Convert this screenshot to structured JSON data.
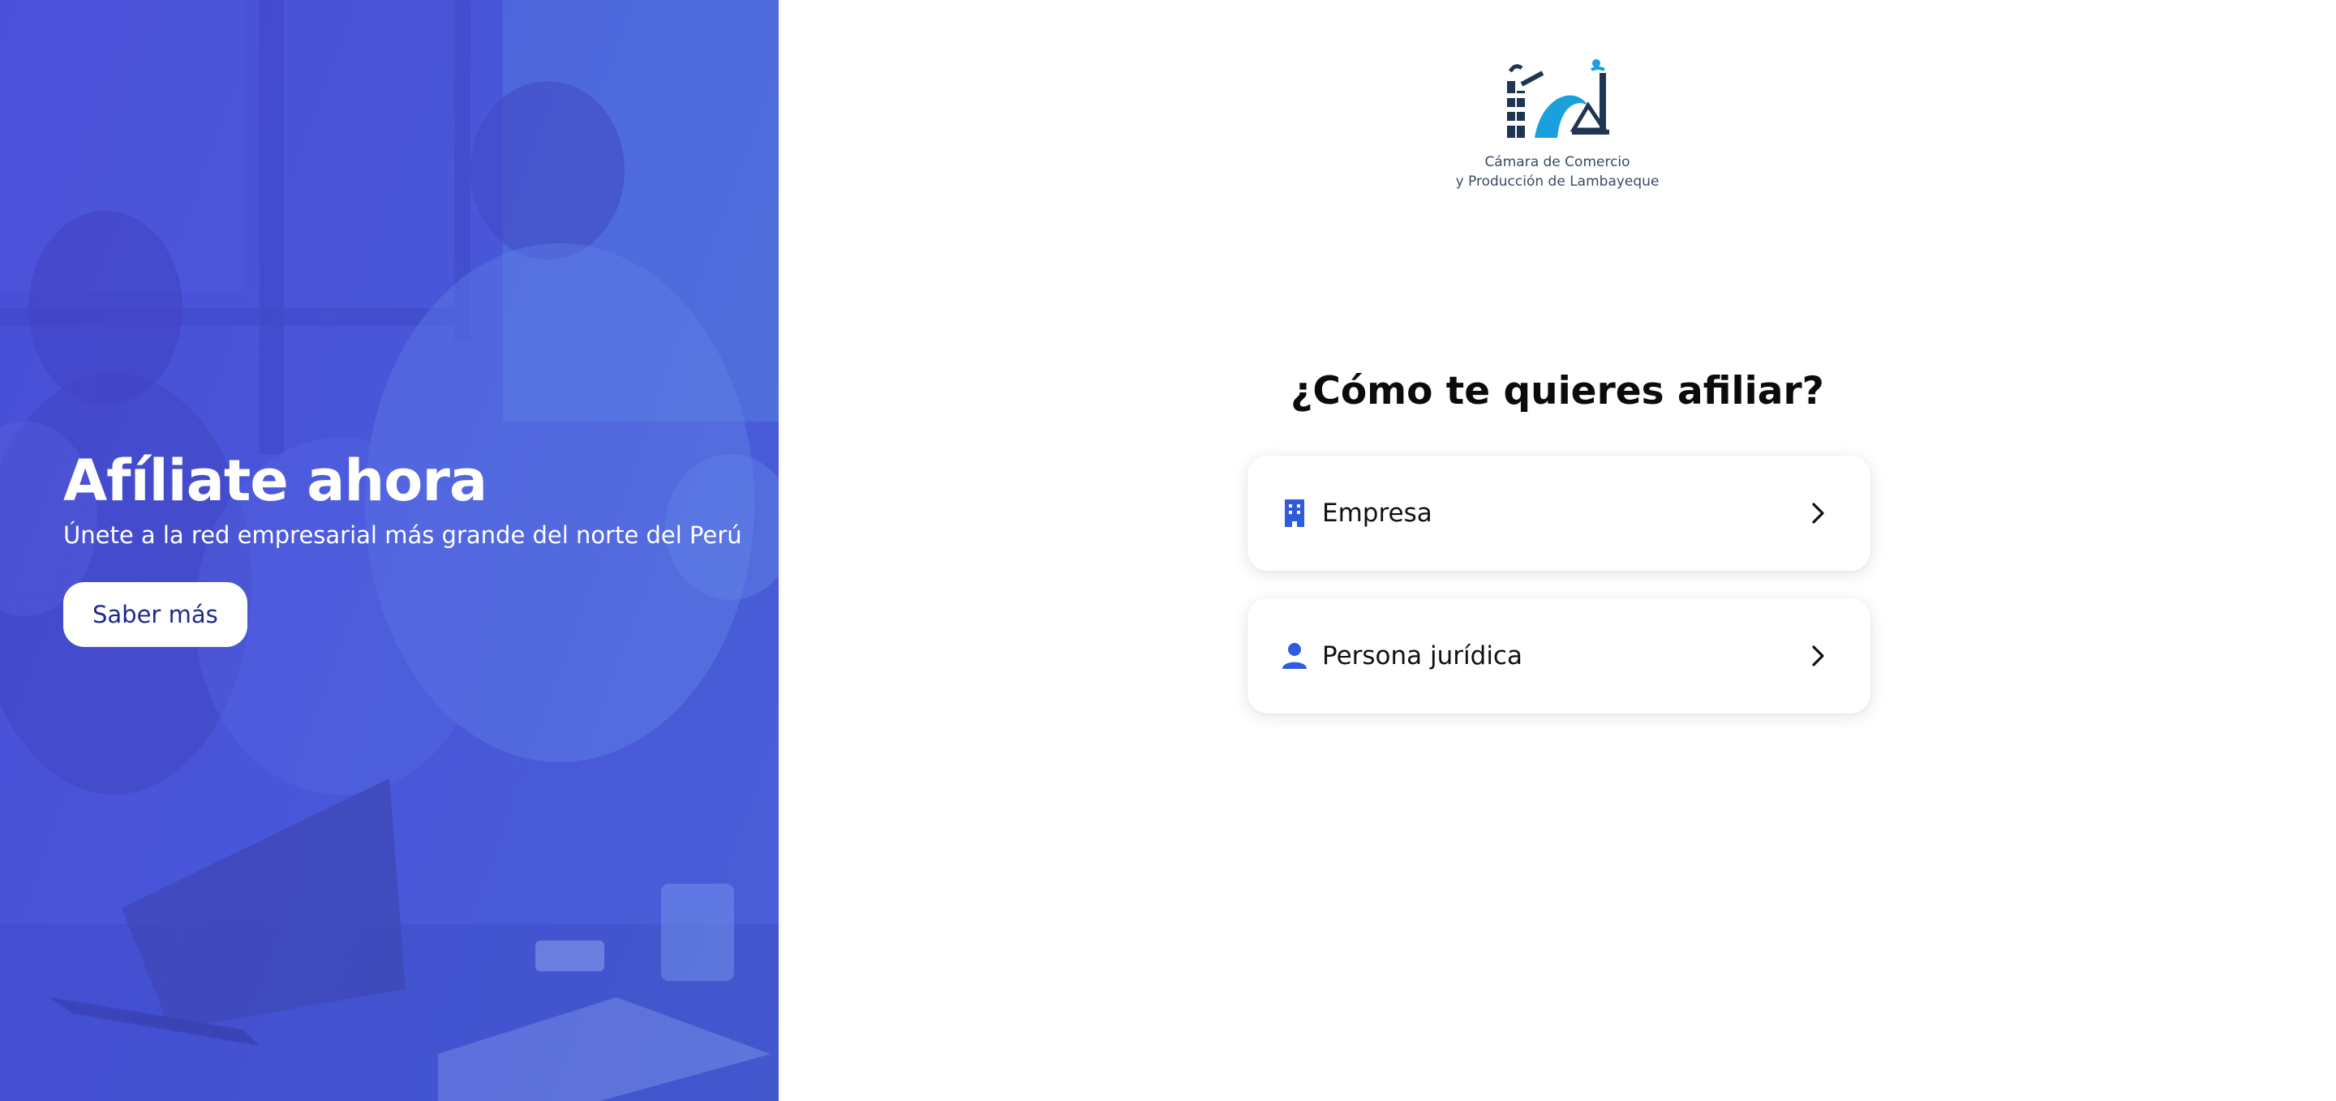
{
  "hero": {
    "title": "Afíliate ahora",
    "subtitle": "Únete a la red empresarial más grande del norte del Perú",
    "button_label": "Saber más"
  },
  "logo": {
    "line1": "Cámara de Comercio",
    "line2": "y Producción de Lambayeque"
  },
  "main": {
    "question": "¿Cómo te quieres afiliar?",
    "options": [
      {
        "label": "Empresa",
        "icon": "building-icon"
      },
      {
        "label": "Persona jurídica",
        "icon": "person-icon"
      }
    ]
  },
  "colors": {
    "accent": "#2f5be0",
    "hero_overlay": "#4b4fd6",
    "button_text": "#1d2a8a"
  }
}
